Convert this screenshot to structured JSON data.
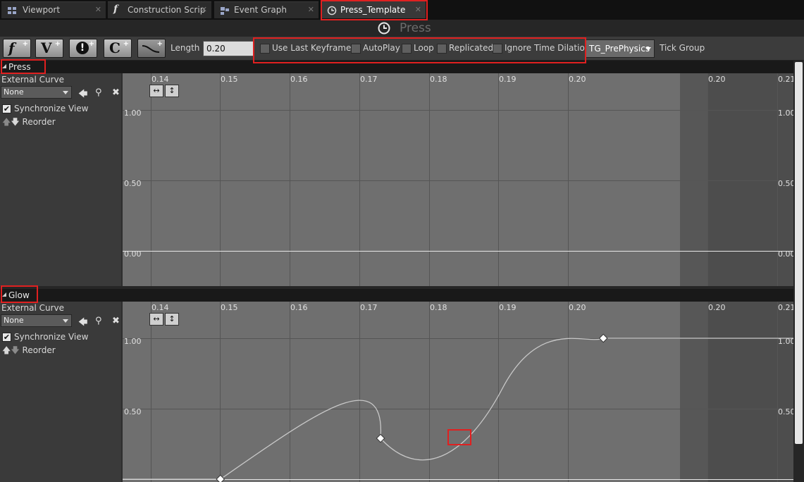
{
  "tabs": [
    {
      "label": "Viewport",
      "icon": "viewport-icon"
    },
    {
      "label": "Construction Scrip",
      "icon": "function-icon"
    },
    {
      "label": "Event Graph",
      "icon": "graph-icon"
    },
    {
      "label": "Press_Template",
      "icon": "timeline-icon",
      "active": true
    }
  ],
  "title": "Press",
  "toolbar": {
    "buttons": [
      {
        "glyph": "f",
        "plus": "+",
        "icon": "add-float-track-icon"
      },
      {
        "glyph": "V",
        "plus": "+",
        "icon": "add-vector-track-icon"
      },
      {
        "glyph": "!",
        "plus": "+",
        "icon": "add-event-track-icon"
      },
      {
        "glyph": "C",
        "plus": "+",
        "icon": "add-color-track-icon"
      },
      {
        "glyph": "",
        "plus": "+",
        "icon": "add-curve-icon"
      }
    ],
    "length_label": "Length",
    "length_value": "0.20",
    "checkboxes": [
      {
        "label": "Use Last Keyframe?",
        "checked": false
      },
      {
        "label": "AutoPlay",
        "checked": false
      },
      {
        "label": "Loop",
        "checked": false
      },
      {
        "label": "Replicated",
        "checked": false
      },
      {
        "label": "Ignore Time Dilation",
        "checked": false
      }
    ],
    "tick_group": "TG_PrePhysics",
    "tick_group_label": "Tick Group"
  },
  "tracks": [
    {
      "name": "Press",
      "external_curve_label": "External Curve",
      "curve_value": "None",
      "sync_label": "Synchronize View",
      "reorder_label": "Reorder",
      "x_ticks": [
        "0.14",
        "0.15",
        "0.16",
        "0.17",
        "0.18",
        "0.19",
        "0.20",
        "0.20",
        "0.21"
      ],
      "y_labels": [
        "1.00",
        "0.50",
        "0.00"
      ],
      "y_labels_right": [
        "1.00",
        "0.50",
        "0.00"
      ],
      "keys": []
    },
    {
      "name": "Glow",
      "external_curve_label": "External Curve",
      "curve_value": "None",
      "sync_label": "Synchronize View",
      "reorder_label": "Reorder",
      "x_ticks": [
        "0.14",
        "0.15",
        "0.16",
        "0.17",
        "0.18",
        "0.19",
        "0.20",
        "0.20",
        "0.21"
      ],
      "y_labels": [
        "1.00",
        "0.50"
      ],
      "y_labels_right": [
        "1.00",
        "0.50"
      ],
      "keys": [
        {
          "time": 0.15,
          "value": 0.0
        },
        {
          "time": 0.173,
          "value": 0.29
        },
        {
          "time": 0.205,
          "value": 1.0
        }
      ]
    }
  ],
  "colors": {
    "highlight": "#e02020",
    "graph_bg": "#6f6f6f",
    "curve": "#c8c8c8"
  }
}
